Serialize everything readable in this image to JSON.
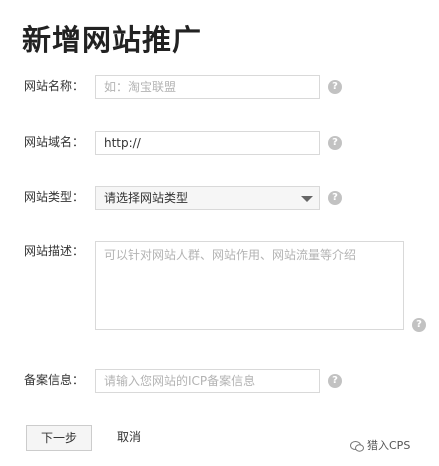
{
  "page": {
    "title": "新增网站推广"
  },
  "form": {
    "name": {
      "label": "网站名称：",
      "placeholder": "如：淘宝联盟"
    },
    "domain": {
      "label": "网站域名：",
      "value": "http://"
    },
    "type": {
      "label": "网站类型：",
      "selected": "请选择网站类型"
    },
    "description": {
      "label": "网站描述：",
      "placeholder": "可以针对网站人群、网站作用、网站流量等介绍"
    },
    "icp": {
      "label": "备案信息：",
      "placeholder": "请输入您网站的ICP备案信息"
    },
    "help_icon": "?"
  },
  "actions": {
    "next_label": "下一步",
    "cancel_label": "取消"
  },
  "watermark": {
    "text": "猎入CPS"
  }
}
